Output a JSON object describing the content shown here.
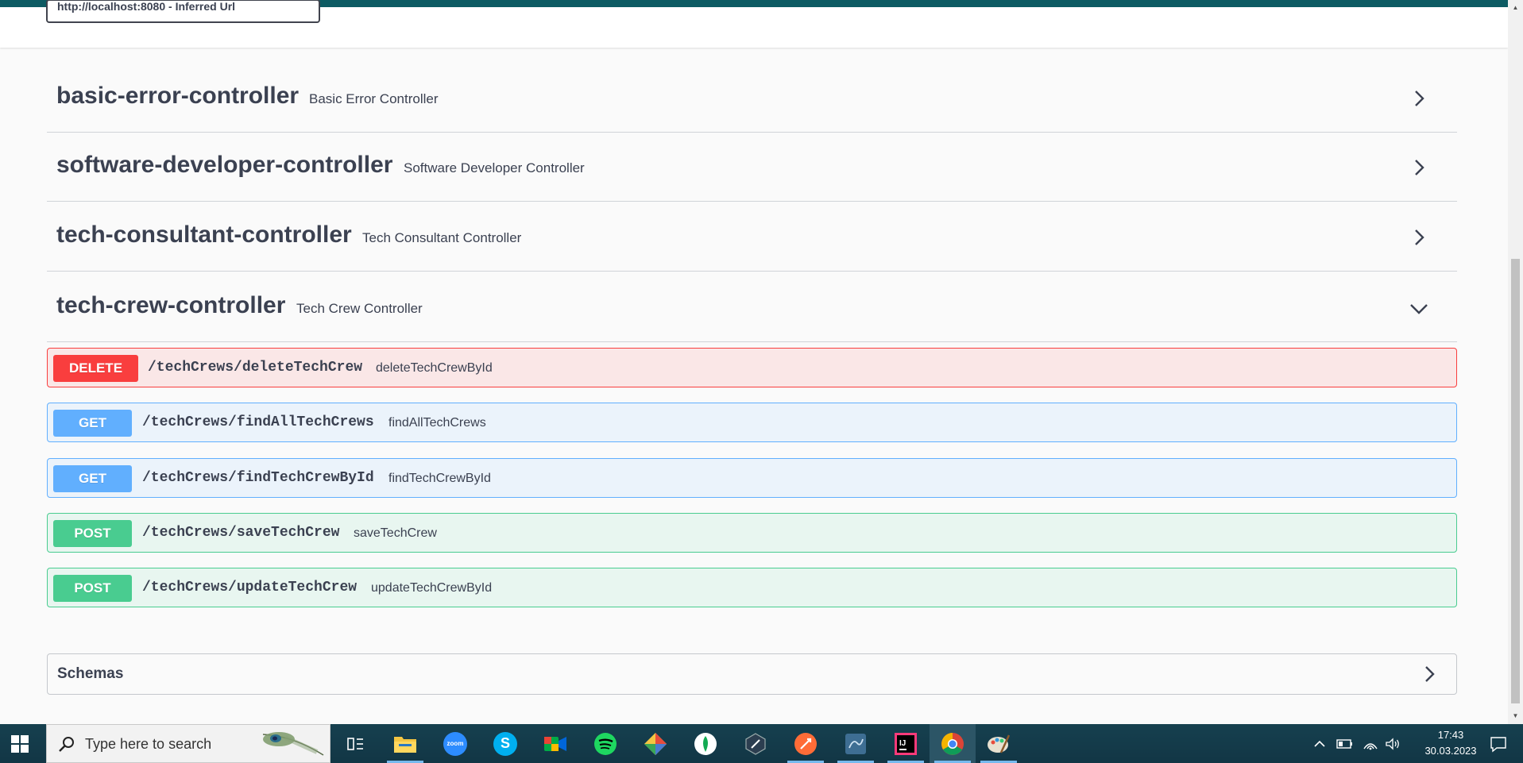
{
  "server_select": {
    "value": "http://localhost:8080 - Inferred Url"
  },
  "tags": [
    {
      "name": "basic-error-controller",
      "description": "Basic Error Controller",
      "expanded": false
    },
    {
      "name": "software-developer-controller",
      "description": "Software Developer Controller",
      "expanded": false
    },
    {
      "name": "tech-consultant-controller",
      "description": "Tech Consultant Controller",
      "expanded": false
    },
    {
      "name": "tech-crew-controller",
      "description": "Tech Crew Controller",
      "expanded": true
    }
  ],
  "operations": [
    {
      "method": "DELETE",
      "path": "/techCrews/deleteTechCrew",
      "summary": "deleteTechCrewById"
    },
    {
      "method": "GET",
      "path": "/techCrews/findAllTechCrews",
      "summary": "findAllTechCrews"
    },
    {
      "method": "GET",
      "path": "/techCrews/findTechCrewById",
      "summary": "findTechCrewById"
    },
    {
      "method": "POST",
      "path": "/techCrews/saveTechCrew",
      "summary": "saveTechCrew"
    },
    {
      "method": "POST",
      "path": "/techCrews/updateTechCrew",
      "summary": "updateTechCrewById"
    }
  ],
  "schemas": {
    "title": "Schemas"
  },
  "colors": {
    "delete": "#f93e3e",
    "get": "#61affe",
    "post": "#49cc90",
    "text": "#3b4151"
  },
  "taskbar": {
    "search_placeholder": "Type here to search",
    "apps": [
      "task-view",
      "file-explorer",
      "zoom",
      "skype",
      "google-meet",
      "spotify",
      "git",
      "mongodb-compass",
      "dbeaver",
      "postman",
      "mysql-workbench",
      "intellij-idea",
      "chrome",
      "paint"
    ],
    "zoom_label": "zoom",
    "intellij_label": "IJ",
    "time": "17:43",
    "date": "30.03.2023"
  }
}
